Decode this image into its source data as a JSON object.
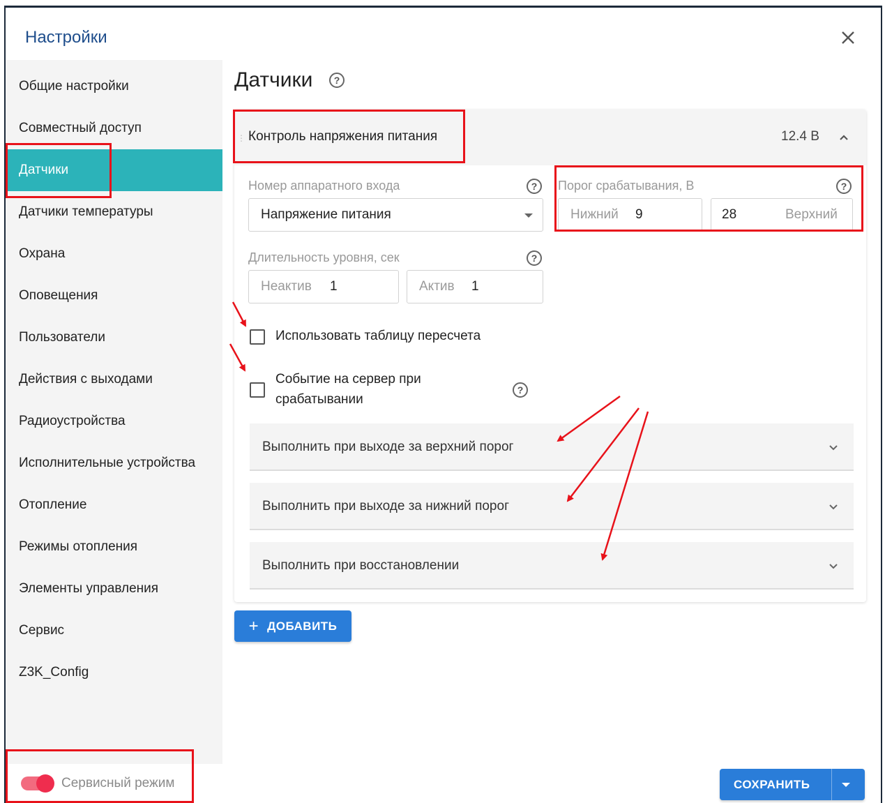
{
  "dialog": {
    "title": "Настройки"
  },
  "sidebar": {
    "items": [
      {
        "label": "Общие настройки"
      },
      {
        "label": "Совместный доступ"
      },
      {
        "label": "Датчики"
      },
      {
        "label": "Датчики температуры"
      },
      {
        "label": "Охрана"
      },
      {
        "label": "Оповещения"
      },
      {
        "label": "Пользователи"
      },
      {
        "label": "Действия с выходами"
      },
      {
        "label": "Радиоустройства"
      },
      {
        "label": "Исполнительные устройства"
      },
      {
        "label": "Отопление"
      },
      {
        "label": "Режимы отопления"
      },
      {
        "label": "Элементы управления"
      },
      {
        "label": "Сервис"
      },
      {
        "label": "Z3K_Config"
      }
    ],
    "active_index": 2,
    "service_mode": {
      "label": "Сервисный режим",
      "enabled": true
    }
  },
  "main": {
    "title": "Датчики",
    "sensor": {
      "title": "Контроль напряжения питания",
      "value": "12.4 В",
      "input": {
        "label": "Номер аппаратного входа",
        "selected": "Напряжение питания"
      },
      "threshold": {
        "label": "Порог срабатывания, В",
        "lower_prefix": "Нижний",
        "lower_value": "9",
        "upper_value": "28",
        "upper_suffix": "Верхний"
      },
      "duration": {
        "label": "Длительность уровня, сек",
        "inactive_prefix": "Неактив",
        "inactive_value": "1",
        "active_prefix": "Актив",
        "active_value": "1"
      },
      "checkbox_table": {
        "label": "Использовать таблицу пересчета",
        "checked": false
      },
      "checkbox_event": {
        "label_line1": "Событие на сервер при",
        "label_line2": "срабатывании",
        "checked": false
      },
      "panels": [
        {
          "label": "Выполнить при выходе за верхний порог"
        },
        {
          "label": "Выполнить при выходе за нижний порог"
        },
        {
          "label": "Выполнить при восстановлении"
        }
      ]
    },
    "add_button": {
      "label": "ДОБАВИТЬ"
    },
    "save_button": {
      "label": "СОХРАНИТЬ"
    }
  },
  "colors": {
    "accent": "#2a7dd9",
    "active_sidebar": "#2cb3b9",
    "annotation_red": "#e8121a",
    "toggle_on": "#ef2d4e"
  },
  "icons": [
    "close-icon",
    "help-icon",
    "chevron-up-icon",
    "chevron-down-icon",
    "dropdown-arrow-icon",
    "plus-icon"
  ]
}
